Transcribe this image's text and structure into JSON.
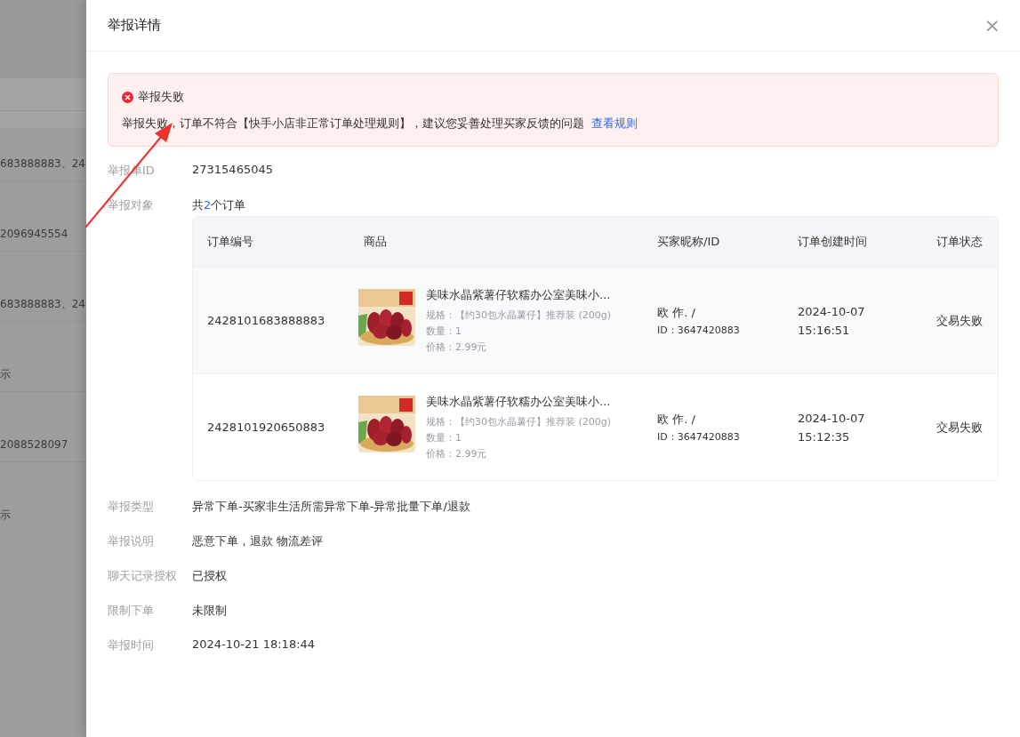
{
  "background_rows": [
    {
      "text": "683888883、24"
    },
    {
      "text": "2096945554"
    },
    {
      "text": "683888883、24"
    },
    {
      "text": "示"
    },
    {
      "text": "2088528097"
    },
    {
      "text": "示"
    }
  ],
  "drawer": {
    "title": "举报详情",
    "close": "×"
  },
  "alert": {
    "title": "举报失败",
    "message": "举报失败，订单不符合【快手小店非正常订单处理规则】，建议您妥善处理买家反馈的问题",
    "link": "查看规则"
  },
  "report_id": {
    "label": "举报单ID",
    "value": "27315465045"
  },
  "target": {
    "label": "举报对象",
    "prefix": "共",
    "count": "2",
    "suffix": "个订单"
  },
  "table": {
    "columns": [
      "订单编号",
      "商品",
      "买家昵称/ID",
      "订单创建时间",
      "订单状态"
    ],
    "rows": [
      {
        "order_no": "2428101683888883",
        "title": "美味水晶紫薯仔软糯办公室美味小...",
        "spec": "规格：【约30包水晶薯仔】推荐装 (200g)",
        "qty": "数量：1",
        "price": "价格：2.99元",
        "buyer": "欧 作. /",
        "buyer_id": "ID：3647420883",
        "date": "2024-10-07",
        "time": "15:16:51",
        "status": "交易失败"
      },
      {
        "order_no": "2428101920650883",
        "title": "美味水晶紫薯仔软糯办公室美味小...",
        "spec": "规格：【约30包水晶薯仔】推荐装 (200g)",
        "qty": "数量：1",
        "price": "价格：2.99元",
        "buyer": "欧 作. /",
        "buyer_id": "ID：3647420883",
        "date": "2024-10-07",
        "time": "15:12:35",
        "status": "交易失败"
      }
    ]
  },
  "fields": [
    {
      "label": "举报类型",
      "value": "异常下单-买家非生活所需异常下单-异常批量下单/退款"
    },
    {
      "label": "举报说明",
      "value": "恶意下单，退款 物流差评"
    },
    {
      "label": "聊天记录授权",
      "value": "已授权"
    },
    {
      "label": "限制下单",
      "value": "未限制"
    },
    {
      "label": "举报时间",
      "value": "2024-10-21 18:18:44"
    }
  ]
}
